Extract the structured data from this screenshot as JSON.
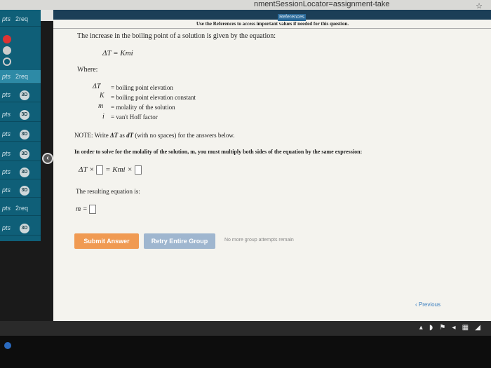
{
  "browser": {
    "url": "nmentSessionLocator=assignment-take",
    "star_icon": "star-icon"
  },
  "sidebar": {
    "items": [
      {
        "pts": "pts",
        "extra": "2req",
        "badge": ""
      },
      {
        "pts": "pts",
        "extra": "2req",
        "badge": ""
      },
      {
        "pts": "pts",
        "extra": "",
        "badge": "3D"
      },
      {
        "pts": "pts",
        "extra": "",
        "badge": "3D"
      },
      {
        "pts": "pts",
        "extra": "",
        "badge": "3D"
      },
      {
        "pts": "pts",
        "extra": "",
        "badge": "3D"
      },
      {
        "pts": "pts",
        "extra": "",
        "badge": "3D"
      },
      {
        "pts": "pts",
        "extra": "",
        "badge": "3D"
      },
      {
        "pts": "pts",
        "extra": "2req",
        "badge": ""
      },
      {
        "pts": "pts",
        "extra": "",
        "badge": "3D"
      }
    ]
  },
  "header": {
    "references": "References",
    "note": "Use the References to access important values if needed for this question."
  },
  "question": {
    "intro": "The increase in the boiling point of a solution is given by the equation:",
    "main_equation": "ΔT = Kmi",
    "where": "Where:",
    "defs": [
      {
        "sym": "ΔT",
        "desc": "= boiling point elevation"
      },
      {
        "sym": "K",
        "desc": "= boiling point elevation constant"
      },
      {
        "sym": "m",
        "desc": "= molality of the solution"
      },
      {
        "sym": "i",
        "desc": "= van't Hoff factor"
      }
    ],
    "note_prefix": "NOTE: Write ",
    "note_sym1": "ΔT",
    "note_mid": " as ",
    "note_sym2": "dT",
    "note_suffix": " (with no spaces) for the answers below.",
    "instruction": "In order to solve for the molality of the solution, m, you must multiply both sides of the equation by the same expression:",
    "eq_left": "ΔT ×",
    "eq_mid": "= Kmi ×",
    "result_label": "The resulting equation is:",
    "m_eq": "m ="
  },
  "actions": {
    "submit": "Submit Answer",
    "retry": "Retry Entire Group",
    "no_more": "No more group attempts remain",
    "previous": "Previous"
  },
  "colors": {
    "sidebar": "#0f5f78",
    "submit": "#f09a52",
    "retry": "#9fb6cf"
  }
}
